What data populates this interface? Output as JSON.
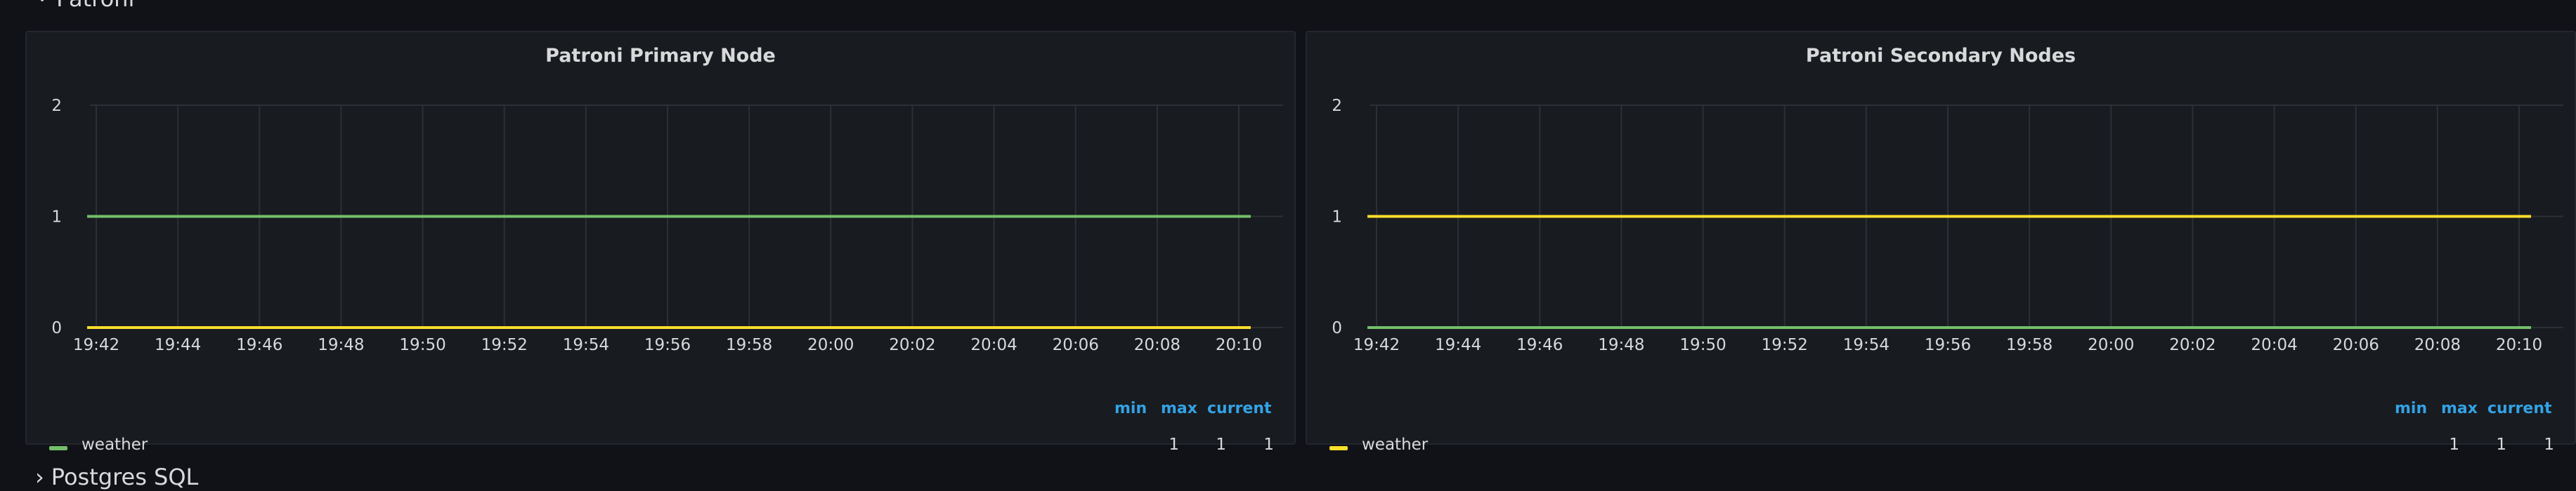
{
  "row_title": "Patroni",
  "next_row_title": "Postgres SQL",
  "panels": [
    {
      "title": "Patroni Primary Node",
      "legend_headers": {
        "min": "min",
        "max": "max",
        "current": "current"
      },
      "legend_series": "weather",
      "legend_values": {
        "min": "1",
        "max": "1",
        "current": "1"
      },
      "series_color": "#73bf69",
      "chart_data": {
        "type": "line",
        "x": [
          "19:42",
          "19:44",
          "19:46",
          "19:48",
          "19:50",
          "19:52",
          "19:54",
          "19:56",
          "19:58",
          "20:00",
          "20:02",
          "20:04",
          "20:06",
          "20:08",
          "20:10"
        ],
        "ylim": [
          0,
          2
        ],
        "yticks": [
          "0",
          "1",
          "2"
        ],
        "grid": true,
        "series": [
          {
            "name": "weather",
            "color": "#73bf69",
            "value": 1
          },
          {
            "color": "#fade2a",
            "value": 0
          }
        ]
      }
    },
    {
      "title": "Patroni Secondary Nodes",
      "legend_headers": {
        "min": "min",
        "max": "max",
        "current": "current"
      },
      "legend_series": "weather",
      "legend_values": {
        "min": "1",
        "max": "1",
        "current": "1"
      },
      "series_color": "#fade2a",
      "chart_data": {
        "type": "line",
        "x": [
          "19:42",
          "19:44",
          "19:46",
          "19:48",
          "19:50",
          "19:52",
          "19:54",
          "19:56",
          "19:58",
          "20:00",
          "20:02",
          "20:04",
          "20:06",
          "20:08",
          "20:10"
        ],
        "ylim": [
          0,
          2
        ],
        "yticks": [
          "0",
          "1",
          "2"
        ],
        "grid": true,
        "series": [
          {
            "name": "weather",
            "color": "#fade2a",
            "value": 1
          },
          {
            "color": "#73bf69",
            "value": 0
          }
        ]
      }
    }
  ]
}
